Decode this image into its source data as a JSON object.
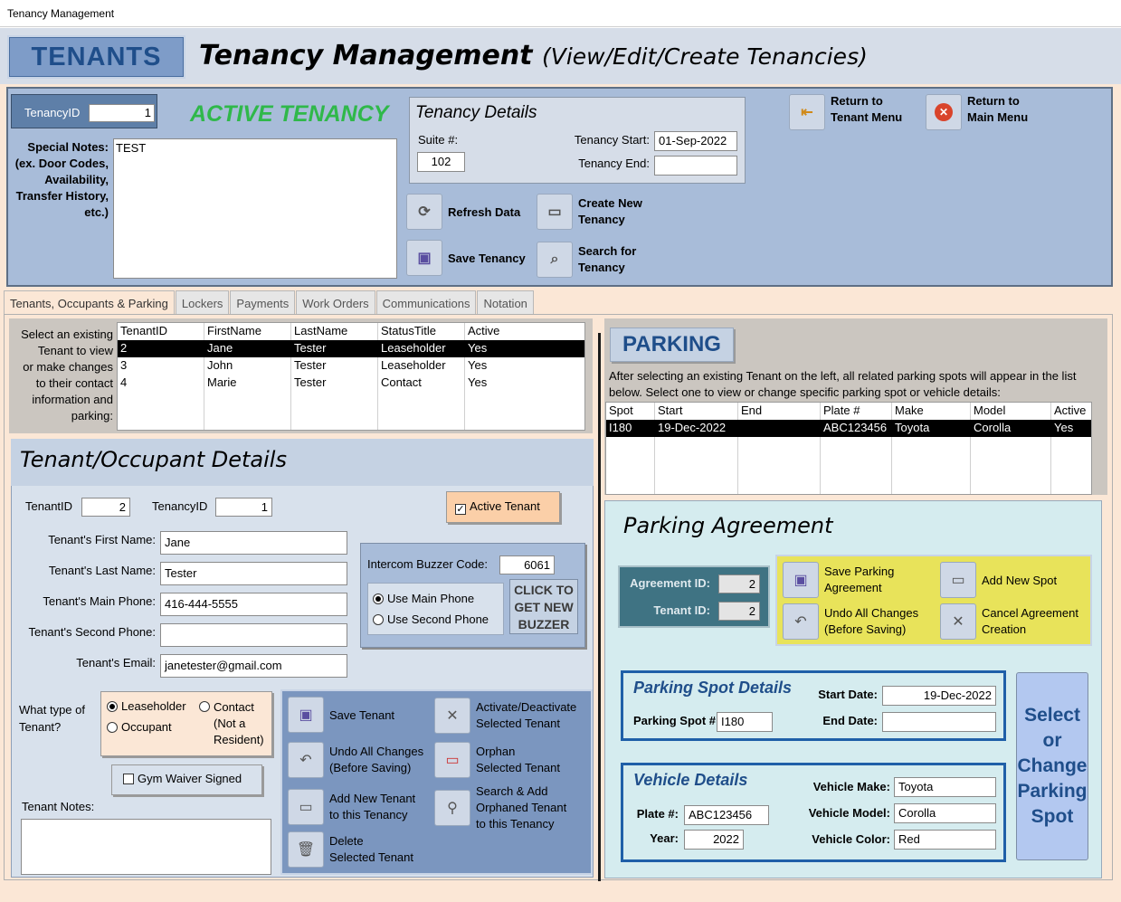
{
  "window": {
    "title": "Tenancy Management"
  },
  "header": {
    "tenants_button": "TENANTS",
    "title": "Tenancy Management",
    "subtitle": "(View/Edit/Create Tenancies)"
  },
  "top": {
    "tenancy_id_label": "TenancyID",
    "tenancy_id_value": "1",
    "active_status": "ACTIVE TENANCY",
    "special_notes_label": "Special Notes:\n(ex. Door Codes,\nAvailability,\nTransfer History,\netc.)",
    "special_notes_value": "TEST",
    "details_title": "Tenancy Details",
    "suite_label": "Suite #:",
    "suite_value": "102",
    "start_label": "Tenancy Start:",
    "start_value": "01-Sep-2022",
    "end_label": "Tenancy End:",
    "end_value": "",
    "refresh": "Refresh Data",
    "create_new": "Create New\nTenancy",
    "save": "Save Tenancy",
    "search": "Search for\nTenancy",
    "return_tenant": "Return to\nTenant Menu",
    "return_main": "Return to\nMain Menu"
  },
  "tabs": [
    "Tenants, Occupants & Parking",
    "Lockers",
    "Payments",
    "Work Orders",
    "Communications",
    "Notation"
  ],
  "tenant_list": {
    "instructions": "Select an existing\nTenant to view\nor make changes\nto their contact\ninformation and\nparking:",
    "columns": [
      "TenantID",
      "FirstName",
      "LastName",
      "StatusTitle",
      "Active"
    ],
    "rows": [
      [
        "2",
        "Jane",
        "Tester",
        "Leaseholder",
        "Yes"
      ],
      [
        "3",
        "John",
        "Tester",
        "Leaseholder",
        "Yes"
      ],
      [
        "4",
        "Marie",
        "Tester",
        "Contact",
        "Yes"
      ]
    ]
  },
  "tenant_details": {
    "title": "Tenant/Occupant Details",
    "tenant_id_label": "TenantID",
    "tenant_id_value": "2",
    "tenancy_id_label": "TenancyID",
    "tenancy_id_value": "1",
    "active_tenant_label": "Active Tenant",
    "first_name_label": "Tenant's First Name:",
    "first_name_value": "Jane",
    "last_name_label": "Tenant's Last Name:",
    "last_name_value": "Tester",
    "main_phone_label": "Tenant's Main Phone:",
    "main_phone_value": "416-444-5555",
    "second_phone_label": "Tenant's Second Phone:",
    "second_phone_value": "",
    "email_label": "Tenant's Email:",
    "email_value": "janetester@gmail.com",
    "buzzer_label": "Intercom Buzzer Code:",
    "buzzer_value": "6061",
    "use_main_phone": "Use Main Phone",
    "use_second_phone": "Use Second Phone",
    "new_buzzer": "CLICK TO\nGET NEW\nBUZZER",
    "type_label": "What type of\nTenant?",
    "leaseholder": "Leaseholder",
    "occupant": "Occupant",
    "contact": "Contact\n(Not a\nResident)",
    "gym_waiver": "Gym Waiver Signed",
    "notes_label": "Tenant Notes:",
    "notes_value": "",
    "save_tenant": "Save Tenant",
    "undo": "Undo All Changes\n(Before Saving)",
    "add_new": "Add New Tenant\nto this Tenancy",
    "delete": "Delete\nSelected Tenant",
    "activate": "Activate/Deactivate\nSelected Tenant",
    "orphan": "Orphan\nSelected Tenant",
    "search_add": "Search & Add\nOrphaned Tenant\nto this Tenancy"
  },
  "parking": {
    "heading": "PARKING",
    "instructions": "After selecting an existing Tenant on the left, all related parking spots will appear in the list below. Select one to view or change specific parking spot or vehicle details:",
    "columns": [
      "Spot",
      "Start",
      "End",
      "Plate #",
      "Make",
      "Model",
      "Active"
    ],
    "rows": [
      [
        "I180",
        "19-Dec-2022",
        "",
        "ABC123456",
        "Toyota",
        "Corolla",
        "Yes"
      ]
    ],
    "agreement_title": "Parking Agreement",
    "agreement_id_label": "Agreement ID:",
    "agreement_id_value": "2",
    "tenant_id_label": "Tenant ID:",
    "tenant_id_value": "2",
    "save_agreement": "Save Parking\nAgreement",
    "add_spot": "Add New Spot",
    "undo": "Undo All Changes\n(Before Saving)",
    "cancel": "Cancel Agreement\nCreation",
    "spot_title": "Parking Spot Details",
    "spot_label": "Parking Spot #:",
    "spot_value": "I180",
    "start_label": "Start Date:",
    "start_value": "19-Dec-2022",
    "end_label": "End Date:",
    "end_value": "",
    "vehicle_title": "Vehicle Details",
    "plate_label": "Plate #:",
    "plate_value": "ABC123456",
    "year_label": "Year:",
    "year_value": "2022",
    "make_label": "Vehicle Make:",
    "make_value": "Toyota",
    "model_label": "Vehicle Model:",
    "model_value": "Corolla",
    "color_label": "Vehicle Color:",
    "color_value": "Red",
    "select_spot": "Select\nor\nChange\nParking\nSpot"
  },
  "colors": {
    "active_green": "#2fb84a",
    "brand_blue": "#1f4e8a",
    "panel_blue": "#a8bcd9",
    "peach": "#fbe7d6",
    "yellow": "#e8e35a"
  }
}
